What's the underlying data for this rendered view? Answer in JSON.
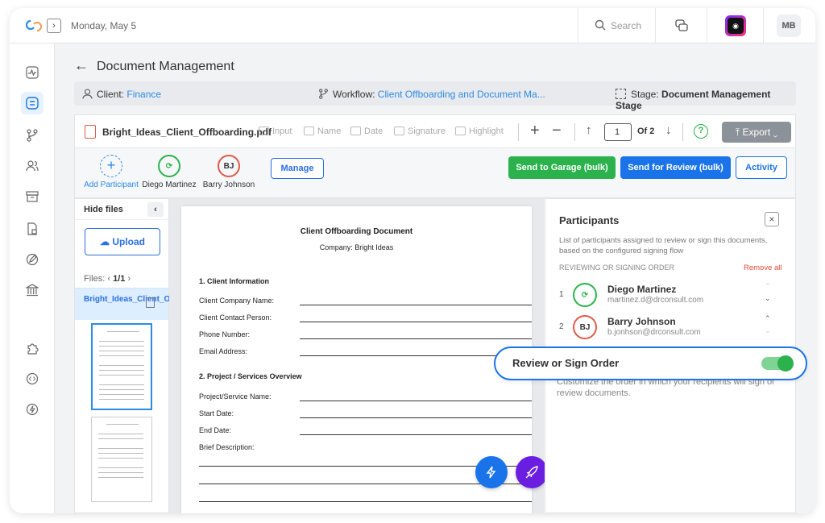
{
  "topbar": {
    "date": "Monday, May 5",
    "search_placeholder": "Search",
    "user_initials": "MB"
  },
  "page": {
    "title": "Document Management"
  },
  "info_bar": {
    "client_label": "Client:",
    "client_value": "Finance",
    "workflow_label": "Workflow:",
    "workflow_value": "Client Offboarding and Document Ma...",
    "stage_label": "Stage:",
    "stage_value": "Document Management Stage"
  },
  "toolbar": {
    "file_name": "Bright_Ideas_Client_Offboarding.pdf",
    "tools": [
      "Input",
      "Name",
      "Date",
      "Signature",
      "Highlight"
    ],
    "page_current": "1",
    "page_of": "Of 2",
    "export_label": "Export"
  },
  "participants_bar": {
    "add_label": "Add Participant",
    "participants": [
      {
        "initials": "",
        "name": "Diego Martinez"
      },
      {
        "initials": "BJ",
        "name": "Barry Johnson"
      }
    ],
    "manage_label": "Manage",
    "send_garage_label": "Send to Garage (bulk)",
    "send_review_label": "Send for Review (bulk)",
    "activity_label": "Activity"
  },
  "files_panel": {
    "hide_label": "Hide files",
    "upload_label": "Upload",
    "files_label": "Files:",
    "files_page": "1/1",
    "file_item_name": "Bright_Ideas_Client_Offboardi..."
  },
  "document": {
    "title": "Client Offboarding Document",
    "company": "Company: Bright Ideas",
    "section1": "1. Client Information",
    "fields1": [
      "Client Company Name:",
      "Client Contact Person:",
      "Phone Number:",
      "Email Address:"
    ],
    "section2": "2. Project / Services Overview",
    "fields2": [
      "Project/Service Name:",
      "Start Date:",
      "End Date:",
      "Brief Description:"
    ]
  },
  "right_panel": {
    "title": "Participants",
    "description": "List of participants assigned to review or sign this documents, based on the configured signing flow",
    "order_label": "REVIEWING OR SIGNING ORDER",
    "remove_all_label": "Remove all",
    "signers": [
      {
        "number": "1",
        "initials": "",
        "name": "Diego Martinez",
        "email": "martinez.d@drconsult.com"
      },
      {
        "number": "2",
        "initials": "BJ",
        "name": "Barry Johnson",
        "email": "b.jonhson@drconsult.com"
      }
    ],
    "hint": "Customize the order in which your recipients will sign or review documents."
  },
  "toggle": {
    "label": "Review or Sign Order",
    "enabled": true
  },
  "colors": {
    "primary": "#1a73e8",
    "success": "#2bb24c",
    "danger": "#e24a3b",
    "fab_purple": "#6a1fe0",
    "fab_orange": "#f5a25a"
  }
}
